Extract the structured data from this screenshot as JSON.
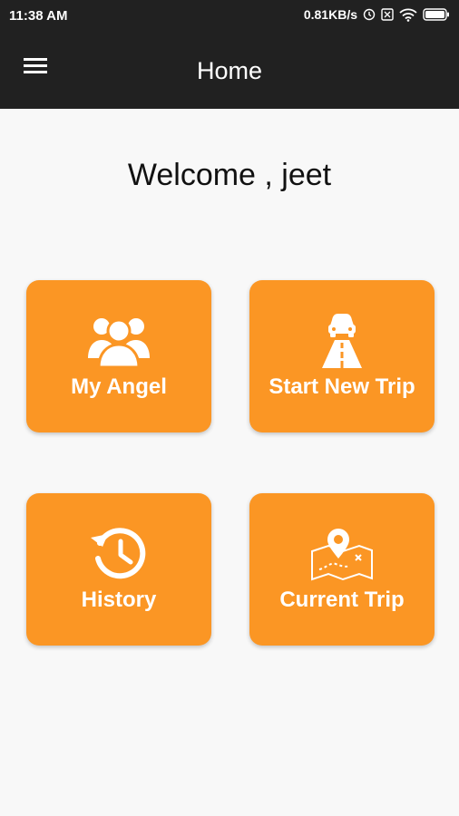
{
  "status_bar": {
    "time": "11:38 AM",
    "speed": "0.81KB/s",
    "icons": [
      "alarm-icon",
      "sim-icon",
      "wifi-icon",
      "battery-icon"
    ]
  },
  "app_bar": {
    "title": "Home",
    "menu_icon": "hamburger-menu-icon"
  },
  "welcome_text": "Welcome , jeet",
  "tiles": [
    {
      "label": "My Angel",
      "icon": "group-people-icon"
    },
    {
      "label": "Start New Trip",
      "icon": "car-road-icon"
    },
    {
      "label": "History",
      "icon": "history-clock-icon"
    },
    {
      "label": "Current Trip",
      "icon": "map-pin-route-icon"
    }
  ],
  "colors": {
    "app_bar": "#212121",
    "tile": "#fb9624",
    "background": "#f8f8f8"
  }
}
